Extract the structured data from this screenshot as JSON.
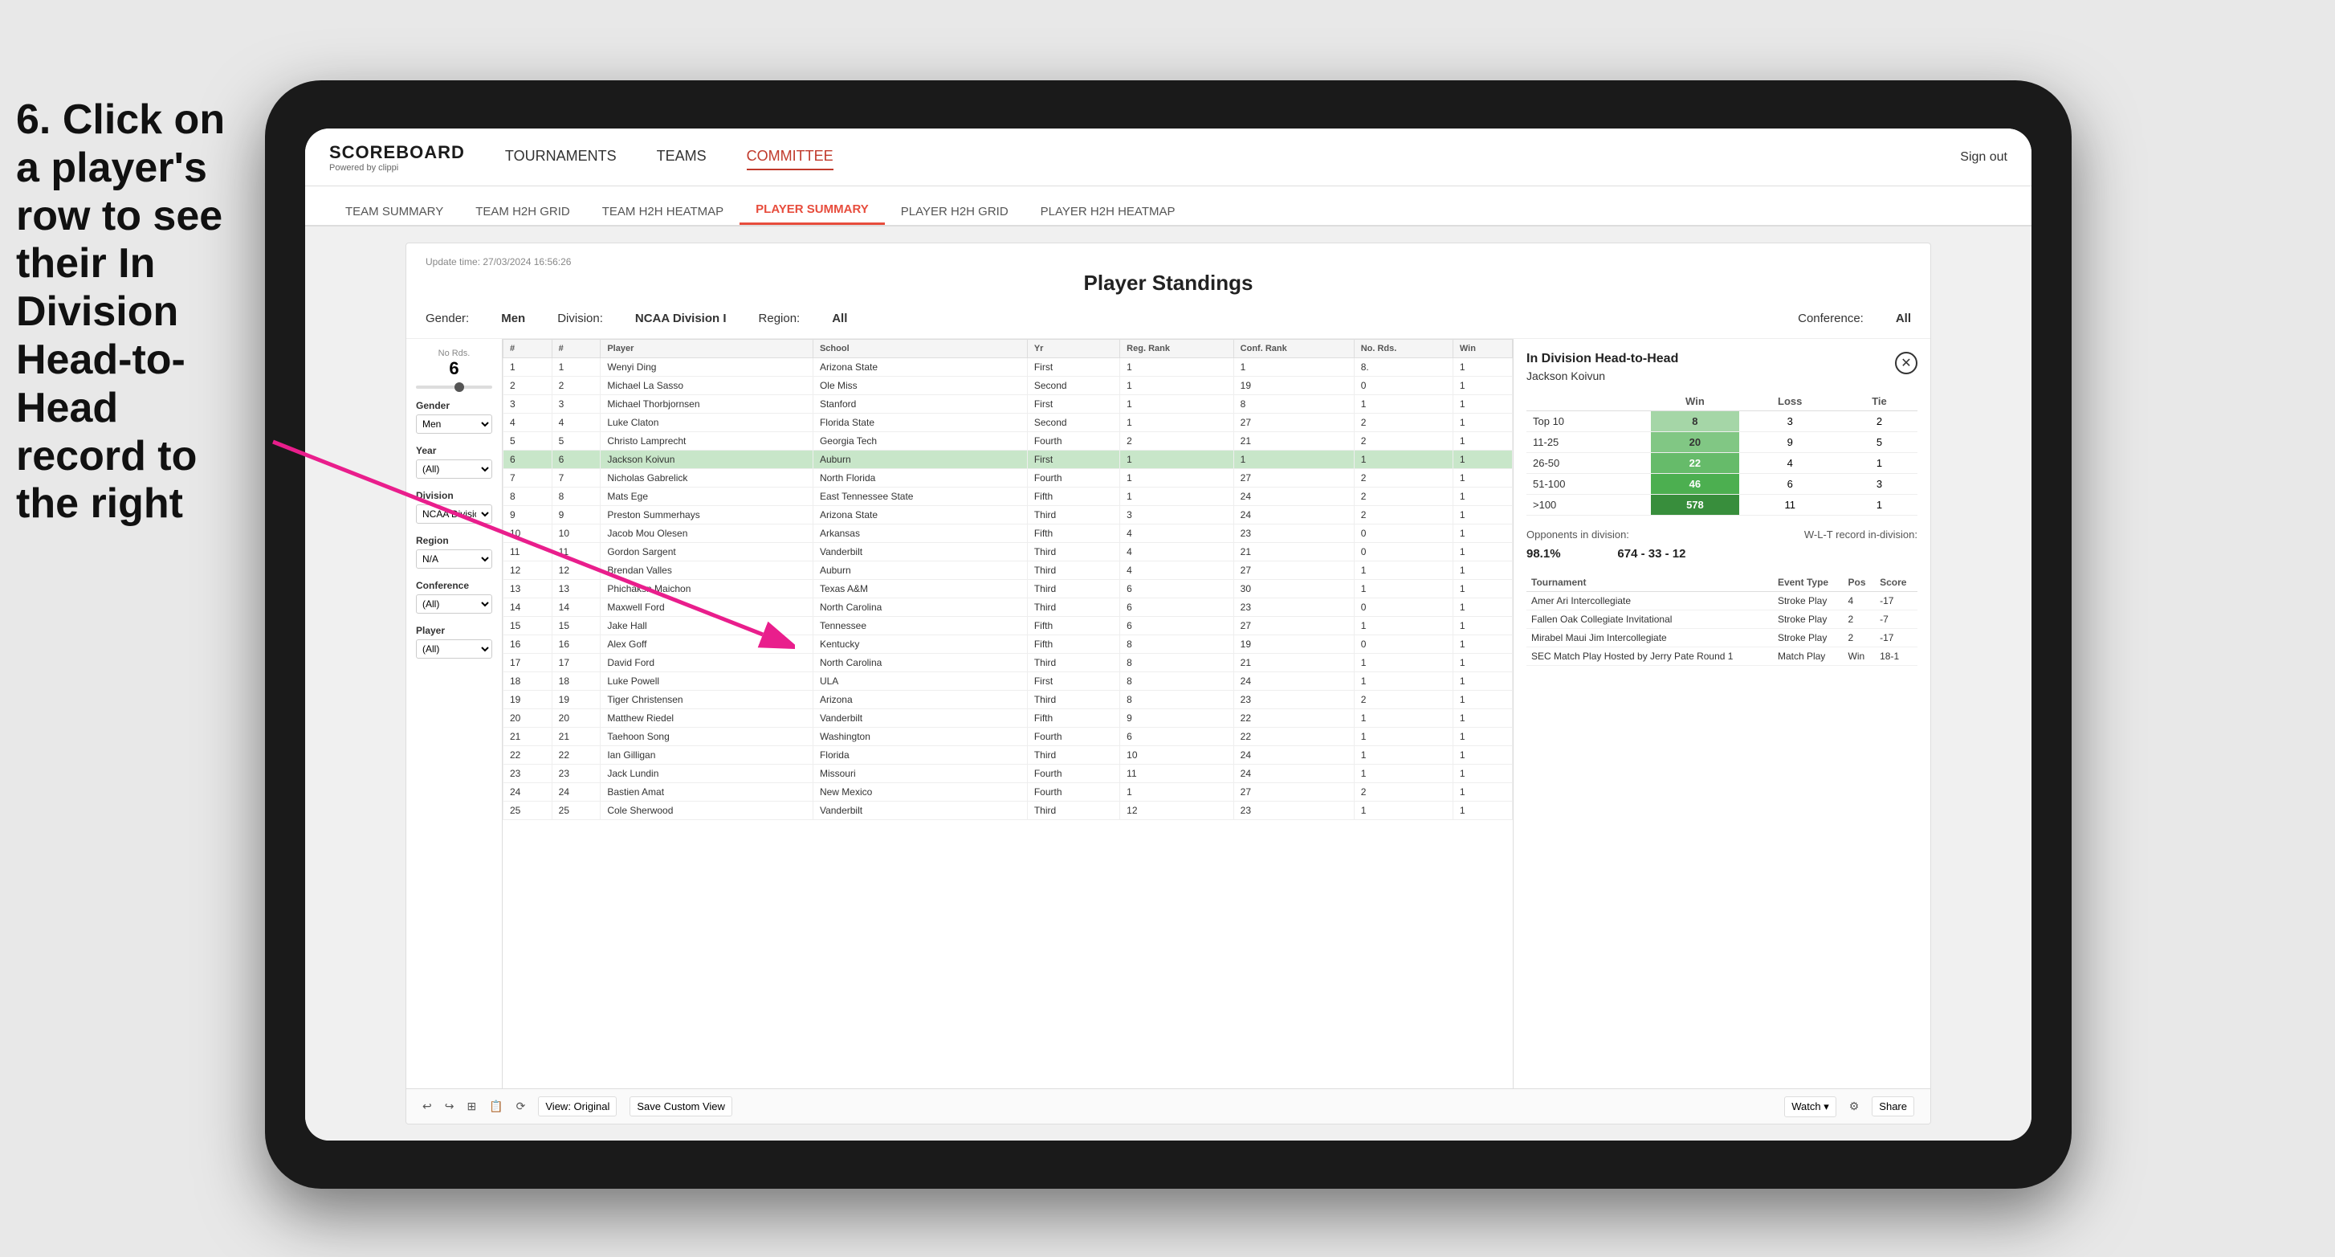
{
  "instruction": {
    "text": "6. Click on a player's row to see their In Division Head-to-Head record to the right"
  },
  "tablet": {
    "nav": {
      "logo": "SCOREBOARD",
      "logo_sub": "Powered by clippi",
      "items": [
        "TOURNAMENTS",
        "TEAMS",
        "COMMITTEE"
      ],
      "sign_out": "Sign out"
    },
    "sub_nav": {
      "items": [
        "TEAM SUMMARY",
        "TEAM H2H GRID",
        "TEAM H2H HEATMAP",
        "PLAYER SUMMARY",
        "PLAYER H2H GRID",
        "PLAYER H2H HEATMAP"
      ],
      "active": "PLAYER SUMMARY"
    },
    "dashboard": {
      "update_time": "Update time: 27/03/2024 16:56:26",
      "title": "Player Standings",
      "filters": {
        "gender_label": "Gender:",
        "gender_value": "Men",
        "division_label": "Division:",
        "division_value": "NCAA Division I",
        "region_label": "Region:",
        "region_value": "All",
        "conference_label": "Conference:",
        "conference_value": "All"
      }
    },
    "left_filters": {
      "no_rds": {
        "label": "No Rds.",
        "value": "6"
      },
      "gender": {
        "label": "Gender",
        "value": "Men"
      },
      "year": {
        "label": "Year",
        "value": "(All)"
      },
      "division": {
        "label": "Division",
        "value": "NCAA Division I"
      },
      "region": {
        "label": "Region",
        "value": "N/A"
      },
      "conference": {
        "label": "Conference",
        "value": "(All)"
      },
      "player": {
        "label": "Player",
        "value": "(All)"
      }
    },
    "players": [
      {
        "rank": "1",
        "num": "1",
        "name": "Wenyi Ding",
        "school": "Arizona State",
        "yr": "First",
        "reg_rank": "1",
        "conf_rank": "1",
        "no_rds": "8.",
        "win": "1"
      },
      {
        "rank": "2",
        "num": "2",
        "name": "Michael La Sasso",
        "school": "Ole Miss",
        "yr": "Second",
        "reg_rank": "1",
        "conf_rank": "19",
        "no_rds": "0",
        "win": "1"
      },
      {
        "rank": "3",
        "num": "3",
        "name": "Michael Thorbjornsen",
        "school": "Stanford",
        "yr": "First",
        "reg_rank": "1",
        "conf_rank": "8",
        "no_rds": "1",
        "win": "1"
      },
      {
        "rank": "4",
        "num": "4",
        "name": "Luke Claton",
        "school": "Florida State",
        "yr": "Second",
        "reg_rank": "1",
        "conf_rank": "27",
        "no_rds": "2",
        "win": "1"
      },
      {
        "rank": "5",
        "num": "5",
        "name": "Christo Lamprecht",
        "school": "Georgia Tech",
        "yr": "Fourth",
        "reg_rank": "2",
        "conf_rank": "21",
        "no_rds": "2",
        "win": "1"
      },
      {
        "rank": "6",
        "num": "6",
        "name": "Jackson Koivun",
        "school": "Auburn",
        "yr": "First",
        "reg_rank": "1",
        "conf_rank": "1",
        "no_rds": "1",
        "win": "1",
        "selected": true
      },
      {
        "rank": "7",
        "num": "7",
        "name": "Nicholas Gabrelick",
        "school": "North Florida",
        "yr": "Fourth",
        "reg_rank": "1",
        "conf_rank": "27",
        "no_rds": "2",
        "win": "1"
      },
      {
        "rank": "8",
        "num": "8",
        "name": "Mats Ege",
        "school": "East Tennessee State",
        "yr": "Fifth",
        "reg_rank": "1",
        "conf_rank": "24",
        "no_rds": "2",
        "win": "1"
      },
      {
        "rank": "9",
        "num": "9",
        "name": "Preston Summerhays",
        "school": "Arizona State",
        "yr": "Third",
        "reg_rank": "3",
        "conf_rank": "24",
        "no_rds": "2",
        "win": "1"
      },
      {
        "rank": "10",
        "num": "10",
        "name": "Jacob Mou Olesen",
        "school": "Arkansas",
        "yr": "Fifth",
        "reg_rank": "4",
        "conf_rank": "23",
        "no_rds": "0",
        "win": "1"
      },
      {
        "rank": "11",
        "num": "11",
        "name": "Gordon Sargent",
        "school": "Vanderbilt",
        "yr": "Third",
        "reg_rank": "4",
        "conf_rank": "21",
        "no_rds": "0",
        "win": "1"
      },
      {
        "rank": "12",
        "num": "12",
        "name": "Brendan Valles",
        "school": "Auburn",
        "yr": "Third",
        "reg_rank": "4",
        "conf_rank": "27",
        "no_rds": "1",
        "win": "1"
      },
      {
        "rank": "13",
        "num": "13",
        "name": "Phichaksn Maichon",
        "school": "Texas A&M",
        "yr": "Third",
        "reg_rank": "6",
        "conf_rank": "30",
        "no_rds": "1",
        "win": "1"
      },
      {
        "rank": "14",
        "num": "14",
        "name": "Maxwell Ford",
        "school": "North Carolina",
        "yr": "Third",
        "reg_rank": "6",
        "conf_rank": "23",
        "no_rds": "0",
        "win": "1"
      },
      {
        "rank": "15",
        "num": "15",
        "name": "Jake Hall",
        "school": "Tennessee",
        "yr": "Fifth",
        "reg_rank": "6",
        "conf_rank": "27",
        "no_rds": "1",
        "win": "1"
      },
      {
        "rank": "16",
        "num": "16",
        "name": "Alex Goff",
        "school": "Kentucky",
        "yr": "Fifth",
        "reg_rank": "8",
        "conf_rank": "19",
        "no_rds": "0",
        "win": "1"
      },
      {
        "rank": "17",
        "num": "17",
        "name": "David Ford",
        "school": "North Carolina",
        "yr": "Third",
        "reg_rank": "8",
        "conf_rank": "21",
        "no_rds": "1",
        "win": "1"
      },
      {
        "rank": "18",
        "num": "18",
        "name": "Luke Powell",
        "school": "ULA",
        "yr": "First",
        "reg_rank": "8",
        "conf_rank": "24",
        "no_rds": "1",
        "win": "1"
      },
      {
        "rank": "19",
        "num": "19",
        "name": "Tiger Christensen",
        "school": "Arizona",
        "yr": "Third",
        "reg_rank": "8",
        "conf_rank": "23",
        "no_rds": "2",
        "win": "1"
      },
      {
        "rank": "20",
        "num": "20",
        "name": "Matthew Riedel",
        "school": "Vanderbilt",
        "yr": "Fifth",
        "reg_rank": "9",
        "conf_rank": "22",
        "no_rds": "1",
        "win": "1"
      },
      {
        "rank": "21",
        "num": "21",
        "name": "Taehoon Song",
        "school": "Washington",
        "yr": "Fourth",
        "reg_rank": "6",
        "conf_rank": "22",
        "no_rds": "1",
        "win": "1"
      },
      {
        "rank": "22",
        "num": "22",
        "name": "Ian Gilligan",
        "school": "Florida",
        "yr": "Third",
        "reg_rank": "10",
        "conf_rank": "24",
        "no_rds": "1",
        "win": "1"
      },
      {
        "rank": "23",
        "num": "23",
        "name": "Jack Lundin",
        "school": "Missouri",
        "yr": "Fourth",
        "reg_rank": "11",
        "conf_rank": "24",
        "no_rds": "1",
        "win": "1"
      },
      {
        "rank": "24",
        "num": "24",
        "name": "Bastien Amat",
        "school": "New Mexico",
        "yr": "Fourth",
        "reg_rank": "1",
        "conf_rank": "27",
        "no_rds": "2",
        "win": "1"
      },
      {
        "rank": "25",
        "num": "25",
        "name": "Cole Sherwood",
        "school": "Vanderbilt",
        "yr": "Third",
        "reg_rank": "12",
        "conf_rank": "23",
        "no_rds": "1",
        "win": "1"
      }
    ],
    "h2h_panel": {
      "title": "In Division Head-to-Head",
      "player_name": "Jackson Koivun",
      "table": {
        "headers": [
          "",
          "Win",
          "Loss",
          "Tie"
        ],
        "rows": [
          {
            "label": "Top 10",
            "win": "8",
            "loss": "3",
            "tie": "2",
            "win_style": "light"
          },
          {
            "label": "11-25",
            "win": "20",
            "loss": "9",
            "tie": "5",
            "win_style": "medium"
          },
          {
            "label": "26-50",
            "win": "22",
            "loss": "4",
            "tie": "1",
            "win_style": "medium"
          },
          {
            "label": "51-100",
            "win": "46",
            "loss": "6",
            "tie": "3",
            "win_style": "dark"
          },
          {
            "label": ">100",
            "win": "578",
            "loss": "11",
            "tie": "1",
            "win_style": "darkest"
          }
        ]
      },
      "opponents_label": "Opponents in division:",
      "wlt_label": "W-L-T record in-division:",
      "opponents_pct": "98.1%",
      "wlt_record": "674 - 33 - 12",
      "tournaments_headers": [
        "Tournament",
        "Event Type",
        "Pos",
        "Score"
      ],
      "tournaments": [
        {
          "name": "Amer Ari Intercollegiate",
          "type": "Stroke Play",
          "pos": "4",
          "score": "-17"
        },
        {
          "name": "Fallen Oak Collegiate Invitational",
          "type": "Stroke Play",
          "pos": "2",
          "score": "-7"
        },
        {
          "name": "Mirabel Maui Jim Intercollegiate",
          "type": "Stroke Play",
          "pos": "2",
          "score": "-17"
        },
        {
          "name": "SEC Match Play Hosted by Jerry Pate Round 1",
          "type": "Match Play",
          "pos": "Win",
          "score": "18-1"
        }
      ]
    },
    "toolbar": {
      "view_original": "View: Original",
      "save_custom": "Save Custom View",
      "watch": "Watch ▾",
      "share": "Share"
    }
  }
}
